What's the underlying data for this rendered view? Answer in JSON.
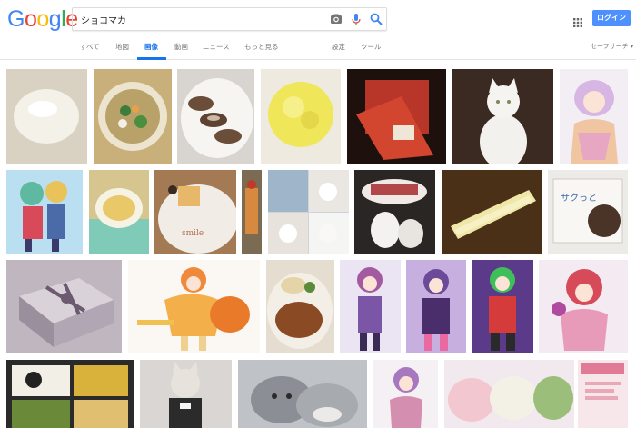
{
  "header": {
    "logo_letters": [
      {
        "ch": "G",
        "color": "#4285F4"
      },
      {
        "ch": "o",
        "color": "#EA4335"
      },
      {
        "ch": "o",
        "color": "#FBBC05"
      },
      {
        "ch": "g",
        "color": "#4285F4"
      },
      {
        "ch": "l",
        "color": "#34A853"
      },
      {
        "ch": "e",
        "color": "#EA4335"
      }
    ],
    "search_value": "ショコマカ",
    "login_label": "ログイン",
    "login_color": "#4d90fe"
  },
  "tabs": {
    "all": "すべて",
    "maps": "地図",
    "images": "画像",
    "videos": "動画",
    "news": "ニュース",
    "more": "もっと見る",
    "settings": "設定",
    "tools": "ツール",
    "safesearch": "セーフサーチ ▾"
  },
  "results": [
    {
      "subject": "white mochi on cloth",
      "palette": [
        "#d9d2c3",
        "#f1efe6"
      ]
    },
    {
      "subject": "soup bowl with vegetables",
      "palette": [
        "#c9b07a",
        "#ece4cf"
      ]
    },
    {
      "subject": "chocolate cookies on plate",
      "palette": [
        "#f4f1ec",
        "#6b4e3a"
      ]
    },
    {
      "subject": "yellow steamed bun",
      "palette": [
        "#f1ea6a",
        "#e8e08a"
      ]
    },
    {
      "subject": "red shopping bag",
      "palette": [
        "#2a1410",
        "#c0392b"
      ]
    },
    {
      "subject": "white cat sitting",
      "palette": [
        "#3a2a22",
        "#f3f1ee"
      ]
    },
    {
      "subject": "anime girl pink hair",
      "palette": [
        "#f2eef4",
        "#d7b6e4"
      ]
    },
    {
      "subject": "anime couple green hair",
      "palette": [
        "#b9dff0",
        "#5fb8a0"
      ]
    },
    {
      "subject": "soup on tray",
      "palette": [
        "#d6c58e",
        "#7fcbb8"
      ]
    },
    {
      "subject": "dessert plate with text",
      "palette": [
        "#f1ede6",
        "#a47a55"
      ]
    },
    {
      "subject": "fruit drink glass",
      "palette": [
        "#7b6b53",
        "#d88940"
      ]
    },
    {
      "subject": "cats collage",
      "palette": [
        "#cfd4da",
        "#f5f5f3"
      ]
    },
    {
      "subject": "cat with treats",
      "palette": [
        "#f0e9e6",
        "#b2474a"
      ]
    },
    {
      "subject": "yellow stick snack",
      "palette": [
        "#4a3017",
        "#efe7a8"
      ]
    },
    {
      "subject": "cookie snack package",
      "palette": [
        "#ecebe8",
        "#4a3428"
      ]
    },
    {
      "subject": "purple gift box",
      "palette": [
        "#bfb6bf",
        "#6c5a70"
      ]
    },
    {
      "subject": "anime orange girl",
      "palette": [
        "#fbf7f2",
        "#ee8a3a"
      ]
    },
    {
      "subject": "curry plate",
      "palette": [
        "#f3efe6",
        "#8a4a24"
      ]
    },
    {
      "subject": "anime purple girl",
      "palette": [
        "#ebe4f3",
        "#7b55a6"
      ]
    },
    {
      "subject": "anime cat girl",
      "palette": [
        "#c7b0e0",
        "#4a2d6b"
      ]
    },
    {
      "subject": "anime boy green hair",
      "palette": [
        "#5b3a8a",
        "#d63b3b"
      ]
    },
    {
      "subject": "anime red hair girl",
      "palette": [
        "#f4eaf2",
        "#d64a5a"
      ]
    },
    {
      "subject": "bento box",
      "palette": [
        "#2a2a2a",
        "#d8b23a"
      ]
    },
    {
      "subject": "cat in dress",
      "palette": [
        "#d9d6d4",
        "#2b2b2b"
      ]
    },
    {
      "subject": "grey kittens",
      "palette": [
        "#bfc2c6",
        "#6f7378"
      ]
    },
    {
      "subject": "anime pink girl small",
      "palette": [
        "#f5f0f3",
        "#d48fb0"
      ]
    },
    {
      "subject": "colored mochi",
      "palette": [
        "#f1e9ee",
        "#9bbf7a"
      ]
    },
    {
      "subject": "pink poster",
      "palette": [
        "#f7e6ea",
        "#e07a96"
      ]
    }
  ]
}
